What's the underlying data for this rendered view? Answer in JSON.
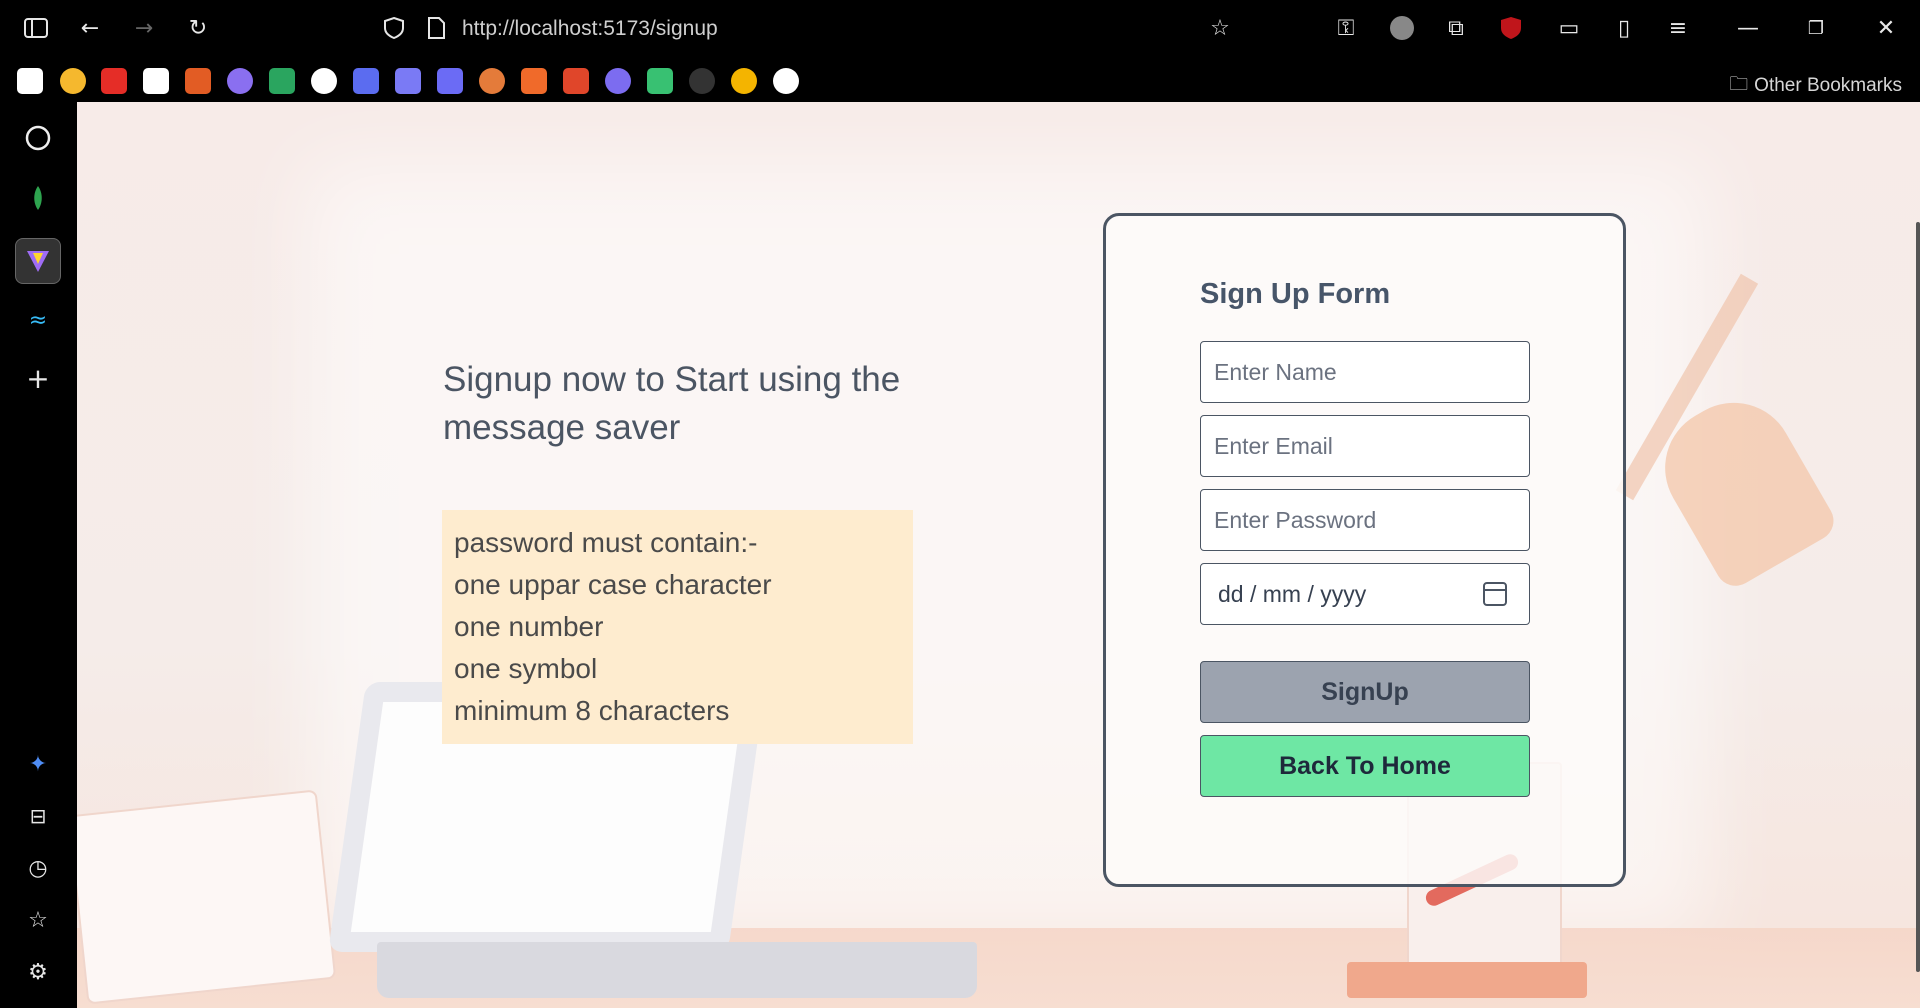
{
  "browser": {
    "url": "http://localhost:5173/signup",
    "other_bookmarks": "Other Bookmarks"
  },
  "page": {
    "headline": "Signup now to Start using the message saver",
    "password_rules": [
      "password must contain:-",
      "one uppar case character",
      "one number",
      "one symbol",
      "minimum 8 characters"
    ]
  },
  "form": {
    "title": "Sign Up Form",
    "name_placeholder": "Enter Name",
    "email_placeholder": "Enter Email",
    "password_placeholder": "Enter Password",
    "date_placeholder": "dd / mm / yyyy",
    "signup_label": "SignUp",
    "home_label": "Back To Home"
  },
  "colors": {
    "card_border": "#4b5563",
    "signup_bg": "#9ca3af",
    "home_bg": "#6ee7a4",
    "rules_bg": "#feeccf"
  }
}
